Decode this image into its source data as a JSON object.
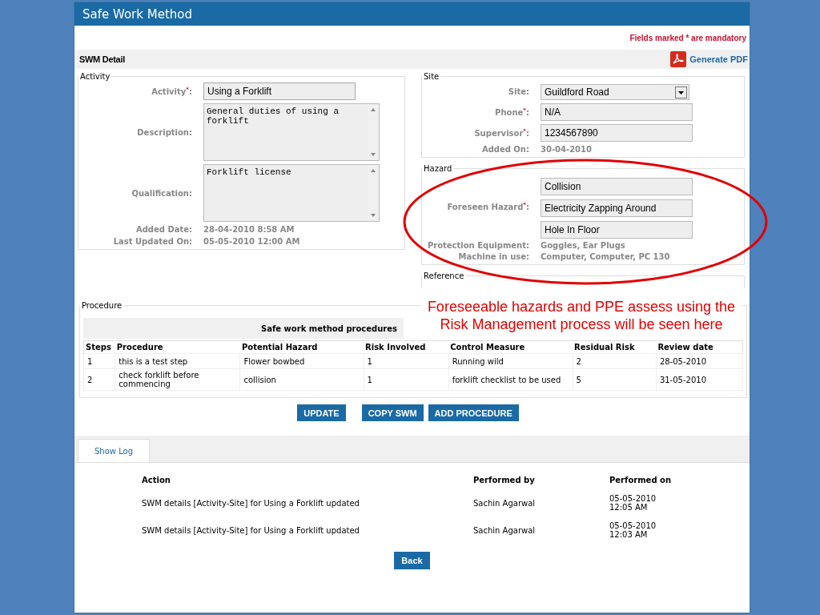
{
  "window": {
    "title": "Safe Work Method"
  },
  "mandatory_note": "Fields marked * are mandatory",
  "section": {
    "title": "SWM Detail",
    "generate_pdf": "Generate PDF"
  },
  "activity": {
    "legend": "Activity",
    "fields": [
      {
        "kind": "input",
        "label": "Activity$^{*}$:",
        "value": "Using a Forklift"
      },
      {
        "kind": "textarea",
        "label": "Description:",
        "value": "General duties of using a forklift"
      },
      {
        "kind": "textarea",
        "label": "Qualification:",
        "value": "Forklift license"
      },
      {
        "kind": "static",
        "label": "Added Date:",
        "value": "28-04-2010 8:58 AM"
      },
      {
        "kind": "static",
        "label": "Last Updated On:",
        "value": "05-05-2010 12:00 AM"
      }
    ]
  },
  "site": {
    "legend": "Site",
    "fields": [
      {
        "kind": "select",
        "label": "Site:",
        "value": "Guildford Road"
      },
      {
        "kind": "input",
        "label": "Phone$^{*}$:",
        "value": "N/A"
      },
      {
        "kind": "input",
        "label": "Supervisor$^{*}$:",
        "value": "1234567890"
      },
      {
        "kind": "static",
        "label": "Added On:",
        "value": "30-04-2010"
      }
    ]
  },
  "hazard": {
    "legend": "Hazard",
    "fields": [
      {
        "kind": "multi",
        "label": "Foreseen Hazard$^{*}$:",
        "values": [
          "Collision",
          "Electricity Zapping Around",
          "Hole In Floor"
        ]
      },
      {
        "kind": "static",
        "label": "Protection Equipment:",
        "value": "Goggles, Ear Plugs"
      },
      {
        "kind": "static",
        "label": "Machine in use:",
        "value": "Computer, Computer, PC 130"
      }
    ]
  },
  "reference": {
    "legend": "Reference"
  },
  "annotation": {
    "text": "Foreseeable hazards and PPE assess using the Risk Management process will be seen here"
  },
  "procedure": {
    "legend": "Procedure",
    "title": "Safe work method procedures",
    "columns": [
      "Steps",
      "Procedure",
      "Potential Hazard",
      "Risk Involved",
      "Control Measure",
      "Residual Risk",
      "Review date"
    ],
    "rows": [
      [
        "1",
        "this is a test step",
        "Flower bowbed",
        "1",
        "Running wild",
        "2",
        "28-05-2010"
      ],
      [
        "2",
        "check forklift before commencing",
        "collision",
        "1",
        "forklift checklist to be used",
        "5",
        "31-05-2010"
      ]
    ]
  },
  "buttons": [
    "UPDATE",
    "COPY SWM",
    "ADD PROCEDURE"
  ],
  "log": {
    "tab": "Show Log",
    "columns": [
      "Action",
      "Performed by",
      "Performed on"
    ],
    "rows": [
      [
        "SWM details [Activity-Site] for Using a Forklift updated",
        "Sachin Agarwal",
        "05-05-2010 12:05 AM"
      ],
      [
        "SWM details [Activity-Site] for Using a Forklift updated",
        "Sachin Agarwal",
        "05-05-2010 12:03 AM"
      ]
    ]
  },
  "back_button": "Back"
}
